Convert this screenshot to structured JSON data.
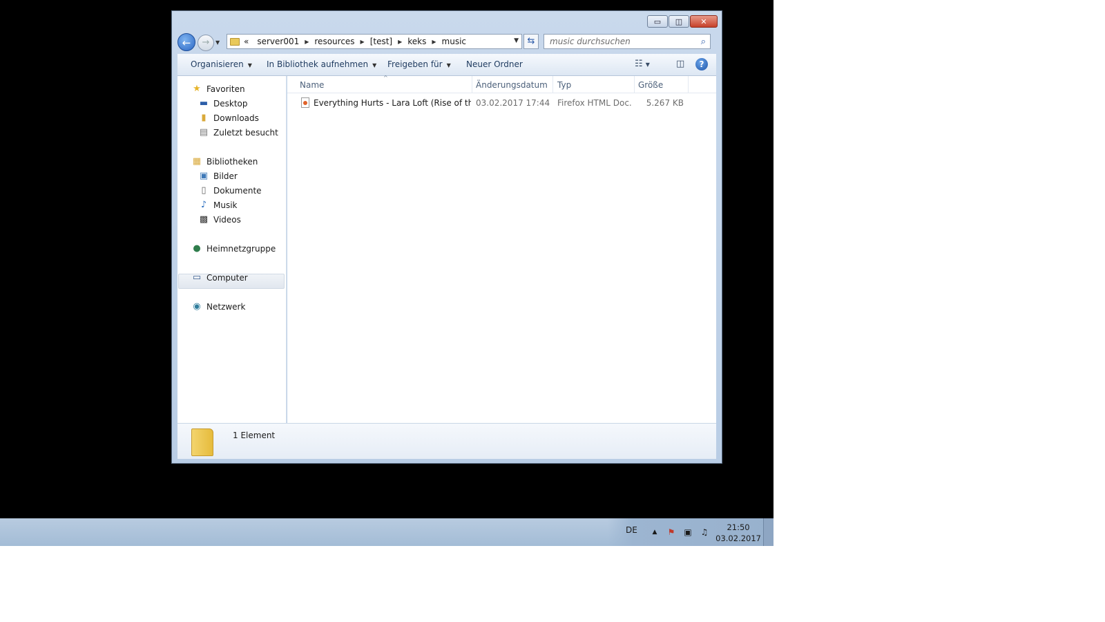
{
  "window": {
    "controls": {
      "minimize": "▭",
      "maximize": "◫",
      "close": "✕"
    }
  },
  "address_bar": {
    "overflow": "«",
    "crumbs": [
      "server001",
      "resources",
      "[test]",
      "keks",
      "music"
    ],
    "search_placeholder": "music durchsuchen"
  },
  "toolbar": {
    "organize": "Organisieren",
    "library": "In Bibliothek aufnehmen",
    "share": "Freigeben für",
    "new_folder": "Neuer Ordner"
  },
  "nav": {
    "favorites": "Favoriten",
    "desktop": "Desktop",
    "downloads": "Downloads",
    "recent": "Zuletzt besucht",
    "libraries": "Bibliotheken",
    "pictures": "Bilder",
    "documents": "Dokumente",
    "music": "Musik",
    "videos": "Videos",
    "homegroup": "Heimnetzgruppe",
    "computer": "Computer",
    "network": "Netzwerk"
  },
  "columns": {
    "name": "Name",
    "date": "Änderungsdatum",
    "type": "Typ",
    "size": "Größe"
  },
  "files": [
    {
      "name": "Everything Hurts - Lara Loft (Rise of the T...",
      "date": "03.02.2017 17:44",
      "type": "Firefox HTML Doc...",
      "size": "5.267 KB"
    }
  ],
  "details": {
    "count": "1 Element"
  },
  "taskbar": {
    "lang": "DE",
    "time": "21:50",
    "date": "03.02.2017"
  },
  "icons": {
    "back": "arrow-left-icon",
    "forward": "arrow-right-icon",
    "refresh": "refresh-icon",
    "search": "magnifier-icon",
    "views": "view-list-icon",
    "preview": "preview-pane-icon",
    "help": "help-icon"
  }
}
